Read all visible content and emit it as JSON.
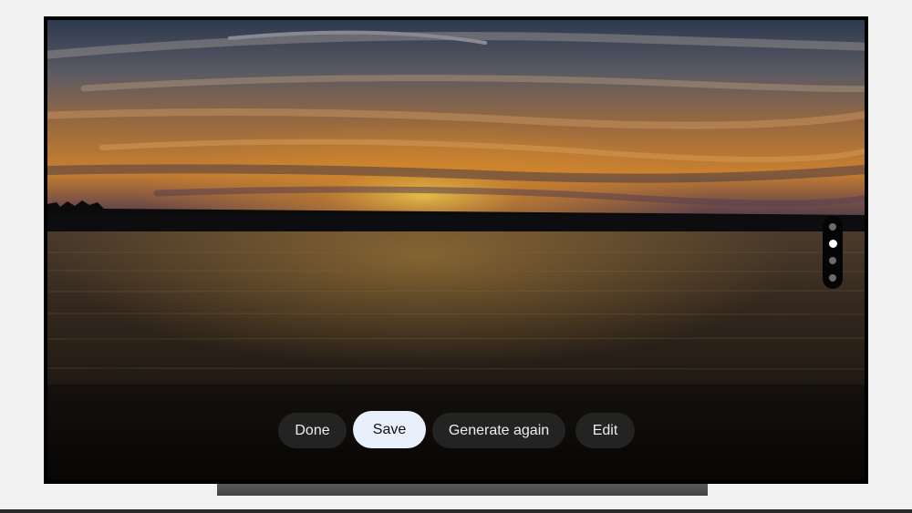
{
  "screen": {
    "background_description_free": true
  },
  "page_indicator": {
    "count": 4,
    "active_index": 1
  },
  "actions": {
    "done_label": "Done",
    "save_label": "Save",
    "generate_again_label": "Generate again",
    "edit_label": "Edit"
  },
  "colors": {
    "selected_pill": "#e8f0fb",
    "pill": "#262626",
    "frame": "#000000",
    "page_background": "#f1f1f1"
  }
}
